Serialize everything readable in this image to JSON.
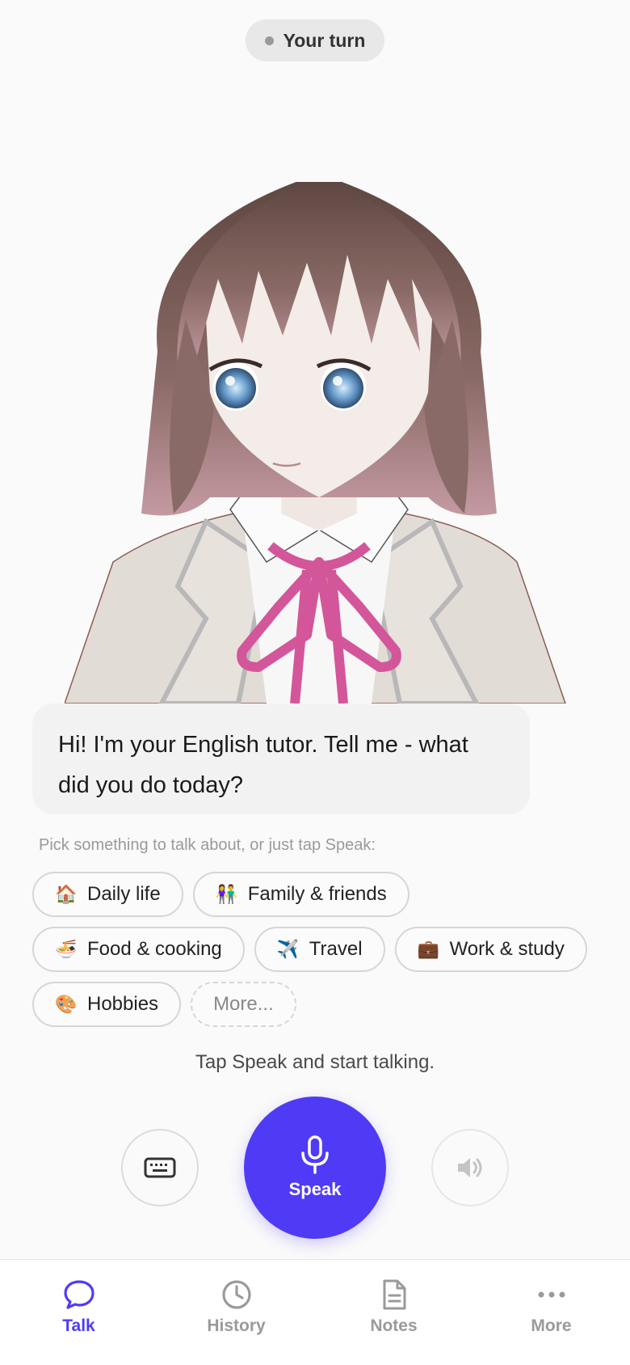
{
  "status": {
    "label": "Your turn"
  },
  "tutor_message": "Hi! I'm your English tutor. Tell me - what did you do today?",
  "topics": {
    "hint": "Pick something to talk about, or just tap Speak:",
    "rows": [
      [
        {
          "icon": "house-icon",
          "emoji": "🏠",
          "label": "Daily life"
        },
        {
          "icon": "people-icon",
          "emoji": "👫",
          "label": "Family & friends"
        }
      ],
      [
        {
          "icon": "noodle-bowl-icon",
          "emoji": "🍜",
          "label": "Food & cooking"
        },
        {
          "icon": "airplane-icon",
          "emoji": "✈️",
          "label": "Travel"
        },
        {
          "icon": "briefcase-icon",
          "emoji": "💼",
          "label": "Work & study"
        }
      ],
      [
        {
          "icon": "palette-icon",
          "emoji": "🎨",
          "label": "Hobbies"
        }
      ]
    ],
    "more_label": "More..."
  },
  "controls": {
    "hint": "Tap Speak and start talking.",
    "speak_label": "Speak",
    "keyboard_icon": "keyboard-icon",
    "speaker_icon": "speaker-icon",
    "mic_icon": "microphone-icon"
  },
  "tabs": [
    {
      "label": "Talk",
      "icon": "chat-bubble-icon",
      "active": true
    },
    {
      "label": "History",
      "icon": "clock-icon",
      "active": false
    },
    {
      "label": "Notes",
      "icon": "document-icon",
      "active": false
    },
    {
      "label": "More",
      "icon": "ellipsis-icon",
      "active": false
    }
  ],
  "colors": {
    "accent": "#4f3bf5",
    "inactive": "#9a9a9a"
  }
}
